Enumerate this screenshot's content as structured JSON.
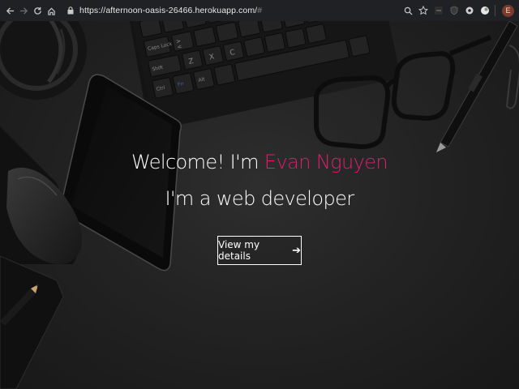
{
  "browser": {
    "url_main": "https://afternoon-oasis-26466.herokuapp.com/",
    "url_hash": "#",
    "profile_initial": "E"
  },
  "hero": {
    "welcome_prefix": "Welcome! I'm ",
    "name": "Evan Nguyen",
    "subtitle": "I'm a web developer",
    "cta_label": "View my details",
    "cta_arrow": "➔",
    "accent_color": "#e31b6d"
  },
  "icons": {
    "back": "back-arrow-icon",
    "forward": "forward-arrow-icon",
    "reload": "reload-icon",
    "home": "home-icon",
    "lock": "lock-icon",
    "zoom": "magnifier-icon",
    "bookmark": "star-icon",
    "cta": "arrow-right-icon"
  },
  "keyboard_keys": [
    "Caps Lock",
    "Shift",
    "Ctrl",
    "Fn",
    "Alt",
    "Z",
    "X",
    "C",
    ">",
    "<"
  ]
}
